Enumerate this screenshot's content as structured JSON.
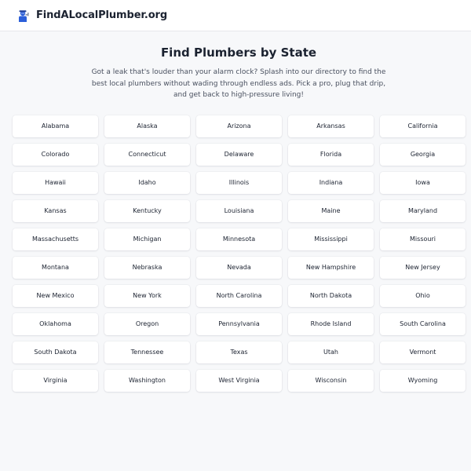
{
  "header": {
    "brand": "FindALocalPlumber.org",
    "logo_icon": "plumber-mascot-icon"
  },
  "main": {
    "title": "Find Plumbers by State",
    "intro": "Got a leak that's louder than your alarm clock? Splash into our directory to find the best local plumbers without wading through endless ads. Pick a pro, plug that drip, and get back to high-pressure living!"
  },
  "states": [
    "Alabama",
    "Alaska",
    "Arizona",
    "Arkansas",
    "California",
    "Colorado",
    "Connecticut",
    "Delaware",
    "Florida",
    "Georgia",
    "Hawaii",
    "Idaho",
    "Illinois",
    "Indiana",
    "Iowa",
    "Kansas",
    "Kentucky",
    "Louisiana",
    "Maine",
    "Maryland",
    "Massachusetts",
    "Michigan",
    "Minnesota",
    "Mississippi",
    "Missouri",
    "Montana",
    "Nebraska",
    "Nevada",
    "New Hampshire",
    "New Jersey",
    "New Mexico",
    "New York",
    "North Carolina",
    "North Dakota",
    "Ohio",
    "Oklahoma",
    "Oregon",
    "Pennsylvania",
    "Rhode Island",
    "South Carolina",
    "South Dakota",
    "Tennessee",
    "Texas",
    "Utah",
    "Vermont",
    "Virginia",
    "Washington",
    "West Virginia",
    "Wisconsin",
    "Wyoming"
  ],
  "colors": {
    "page_bg": "#f7f8fa",
    "card_bg": "#ffffff",
    "text": "#1b2230",
    "muted_text": "#4a5160",
    "logo_blue": "#2b5fd9"
  }
}
